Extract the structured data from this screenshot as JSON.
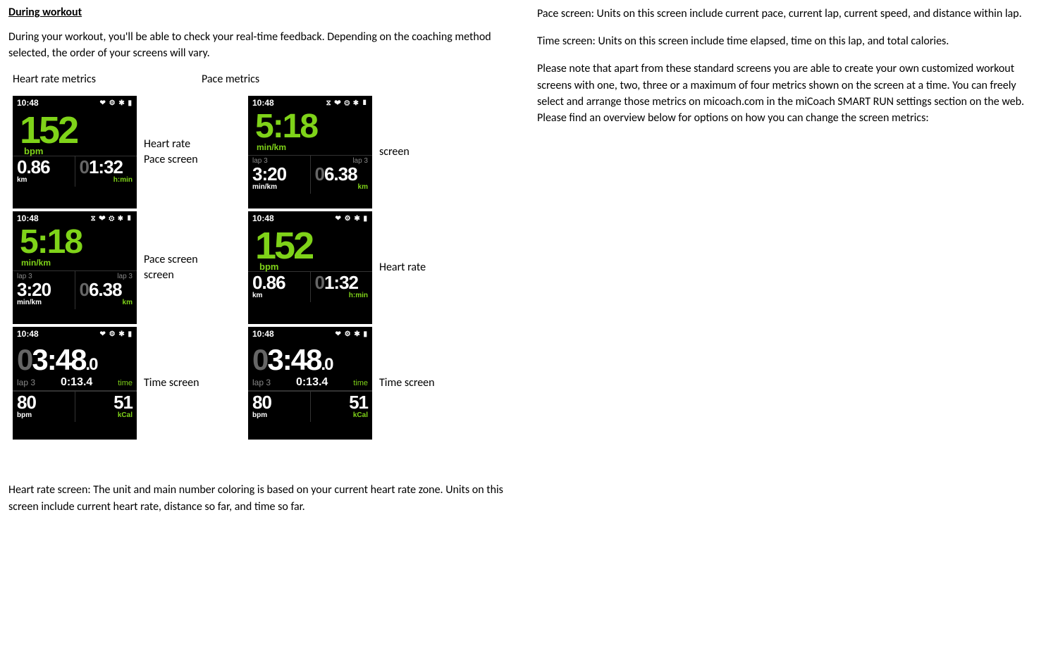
{
  "left": {
    "title": "During workout",
    "intro": "During your workout, you'll be able to check your real-time feedback. Depending on the coaching method selected, the order of your screens will vary.",
    "hr_desc": "Heart rate screen: The unit and main number coloring is based on your current heart rate zone. Units on this screen include current heart rate, distance so far, and time so far."
  },
  "right": {
    "pace_desc": "Pace screen: Units on this screen include current pace, current lap, current speed, and distance within lap.",
    "time_desc": "Time screen: Units on this screen include time elapsed, time on this lap, and total calories.",
    "note": "Please note that apart from these standard screens you are able to create your own customized workout screens with one, two, three or a maximum of four metrics shown on the screen at a time. You can freely select and arrange those metrics on micoach.com in the miCoach SMART RUN settings section on the web.  Please find an overview below for options on how you can change the screen metrics:"
  },
  "headers": {
    "hr": "Heart rate metrics",
    "pace": "Pace metrics"
  },
  "labels": {
    "r1c1a": "Heart rate",
    "r1c1b": "Pace screen",
    "r1c2a": "screen",
    "r2c1a": "Pace screen",
    "r2c1b": "screen",
    "r2c2a": "Heart rate",
    "r3c1": "Time screen",
    "r3c2": "Time screen"
  },
  "watch": {
    "time": "10:48",
    "icons": "❤ ⚙ ✱ ▮",
    "wifi_icons": "⧖ ❤ ⚙ ✱ ▮",
    "hr": {
      "value": "152",
      "unit": "bpm",
      "dist": "0.86",
      "dist_unit": "km",
      "elapsed_grey": "0",
      "elapsed": "1:32",
      "elapsed_unit": "h:min"
    },
    "pace": {
      "value": "5:18",
      "unit": "min/km",
      "lap_lbl": "lap 3",
      "lap_pace": "3:20",
      "lap_pace_unit": "min/km",
      "lap_dist_grey": "0",
      "lap_dist": "6.38",
      "lap_dist_unit": "km"
    },
    "timescr": {
      "big_grey": "0",
      "big_main": "3:48",
      "big_small": ".0",
      "lap_lbl": "lap 3",
      "lap_time": "0:13.4",
      "time_lbl": "time",
      "bpm": "80",
      "bpm_unit": "bpm",
      "kcal": "51",
      "kcal_unit": "kCal"
    }
  }
}
